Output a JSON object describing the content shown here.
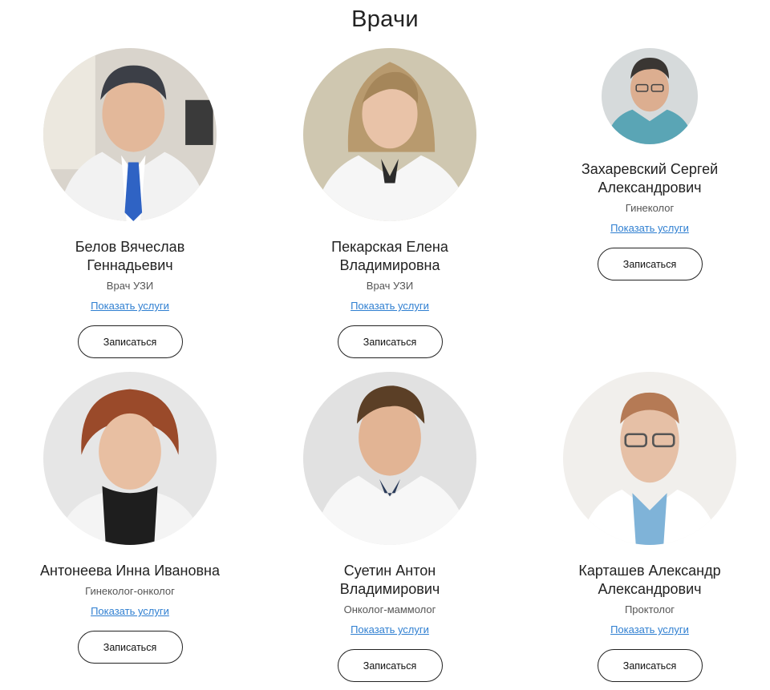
{
  "page": {
    "title": "Врачи"
  },
  "doctors": [
    {
      "name_line1": "Белов Вячеслав",
      "name_line2": "Геннадьевич",
      "role": "Врач УЗИ",
      "services_link": "Показать услуги",
      "book_label": "Записаться"
    },
    {
      "name_line1": "Пекарская Елена",
      "name_line2": "Владимировна",
      "role": "Врач УЗИ",
      "services_link": "Показать услуги",
      "book_label": "Записаться"
    },
    {
      "name_line1": "Захаревский Сергей",
      "name_line2": "Александрович",
      "role": "Гинеколог",
      "services_link": "Показать услуги",
      "book_label": "Записаться"
    },
    {
      "name_line1": "Антонеева Инна Ивановна",
      "name_line2": "",
      "role": "Гинеколог-онколог",
      "services_link": "Показать услуги",
      "book_label": "Записаться"
    },
    {
      "name_line1": "Суетин Антон",
      "name_line2": "Владимирович",
      "role": "Онколог-маммолог",
      "services_link": "Показать услуги",
      "book_label": "Записаться"
    },
    {
      "name_line1": "Карташев Александр",
      "name_line2": "Александрович",
      "role": "Проктолог",
      "services_link": "Показать услуги",
      "book_label": "Записаться"
    }
  ],
  "colors": {
    "link": "#2f7fd1",
    "text": "#222222",
    "button_border": "#222222"
  }
}
